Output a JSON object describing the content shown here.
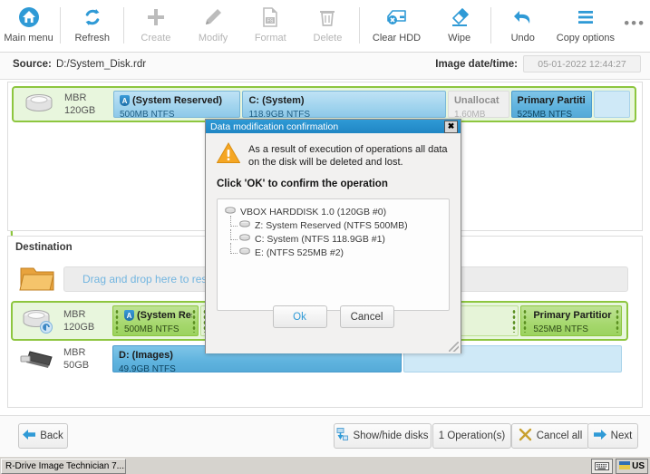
{
  "toolbar": {
    "items": [
      {
        "label": "Main menu",
        "icon": "home-icon",
        "enabled": true
      },
      {
        "label": "Refresh",
        "icon": "refresh-icon",
        "enabled": true
      },
      {
        "label": "Create",
        "icon": "plus-icon",
        "enabled": false
      },
      {
        "label": "Modify",
        "icon": "pencil-icon",
        "enabled": false
      },
      {
        "label": "Format",
        "icon": "format-fs-icon",
        "enabled": false
      },
      {
        "label": "Delete",
        "icon": "trash-icon",
        "enabled": false
      },
      {
        "label": "Clear HDD",
        "icon": "clear-hdd-icon",
        "enabled": true
      },
      {
        "label": "Wipe",
        "icon": "eraser-icon",
        "enabled": true
      },
      {
        "label": "Undo",
        "icon": "undo-arrow-icon",
        "enabled": true
      },
      {
        "label": "Copy options",
        "icon": "hamburger-icon",
        "enabled": true
      }
    ],
    "overflow": "•••"
  },
  "source_bar": {
    "source_label": "Source:",
    "source_value": "D:/System_Disk.rdr",
    "date_label": "Image date/time:",
    "date_value": "05-01-2022 12:44:27"
  },
  "source_panel": {
    "disk": {
      "scheme": "MBR",
      "capacity": "120GB",
      "icon": "hard-disk-icon",
      "partitions": [
        {
          "name": "(System Reserved)",
          "size": "500MB NTFS",
          "style": "blue",
          "width_pct": 25,
          "has_shield": true
        },
        {
          "name": "C: (System)",
          "size": "118.9GB NTFS",
          "style": "blue",
          "width_pct": 40,
          "has_shield": false
        },
        {
          "name": "Unallocat",
          "size": "1.60MB",
          "style": "unalloc",
          "width_pct": 12,
          "has_shield": false
        },
        {
          "name": "Primary Partition",
          "size": "525MB NTFS",
          "style": "blue-dark",
          "width_pct": 16,
          "has_shield": false
        },
        {
          "name": "",
          "size": "",
          "style": "lightblue",
          "width_pct": 7,
          "has_shield": false
        }
      ]
    }
  },
  "dest_panel": {
    "title": "Destination",
    "drop_zone": {
      "text": "Drag and drop here to restore f",
      "icon": "folder-icon"
    },
    "disks": [
      {
        "scheme": "MBR",
        "capacity": "120GB",
        "icon": "hard-disk-restore-icon",
        "selected": true,
        "partitions": [
          {
            "name": "(System Rese",
            "size": "500MB NTFS",
            "style": "green",
            "width_pct": 17,
            "has_shield": true,
            "grips": true
          },
          {
            "name": "",
            "size": "",
            "style": "greenpale",
            "width_pct": 63,
            "has_shield": false,
            "grips": true
          },
          {
            "name": "Primary Partitior",
            "size": "525MB NTFS",
            "style": "green",
            "width_pct": 20,
            "has_shield": false,
            "grips": true
          }
        ]
      },
      {
        "scheme": "MBR",
        "capacity": "50GB",
        "icon": "usb-drive-icon",
        "selected": false,
        "partitions": [
          {
            "name": "D: (Images)",
            "size": "49.9GB NTFS",
            "style": "imgblue",
            "width_pct": 57,
            "has_shield": false,
            "grips": false
          },
          {
            "name": "",
            "size": "",
            "style": "lightblue",
            "width_pct": 43,
            "has_shield": false,
            "grips": false
          }
        ]
      }
    ]
  },
  "dialog": {
    "title": "Data modification confirmation",
    "close_label": "✖",
    "warning_icon": "warning-triangle-icon",
    "warning_text": "As a result of execution of operations all data on the disk will be deleted and lost.",
    "confirm_text": "Click 'OK' to confirm the operation",
    "tree": [
      {
        "label": "VBOX HARDDISK 1.0 (120GB #0)",
        "level": 0,
        "icon": "disk-small-icon"
      },
      {
        "label": "Z: System Reserved (NTFS 500MB)",
        "level": 1,
        "icon": "disk-small-icon"
      },
      {
        "label": "C: System (NTFS 118.9GB #1)",
        "level": 1,
        "icon": "disk-small-icon"
      },
      {
        "label": "E: (NTFS 525MB #2)",
        "level": 1,
        "icon": "disk-small-icon"
      }
    ],
    "ok_label": "Ok",
    "cancel_label": "Cancel"
  },
  "bottom_bar": {
    "back": {
      "label": "Back",
      "icon": "arrow-left-icon"
    },
    "show_hide": {
      "label": "Show/hide disks",
      "icon": "show-hide-icon"
    },
    "operations": {
      "label": "1 Operation(s)"
    },
    "cancel_all": {
      "label": "Cancel all",
      "icon": "x-cross-icon"
    },
    "next": {
      "label": "Next",
      "icon": "arrow-right-icon"
    }
  },
  "taskbar": {
    "app_button": "R-Drive Image Technician 7....",
    "keyboard_icon": "keyboard-icon",
    "language": "US"
  },
  "colors": {
    "accent_blue": "#2f9ad6",
    "green_select": "#8dc63f",
    "partition_blue": "#a5d6ef",
    "warning_orange": "#f5a623"
  }
}
